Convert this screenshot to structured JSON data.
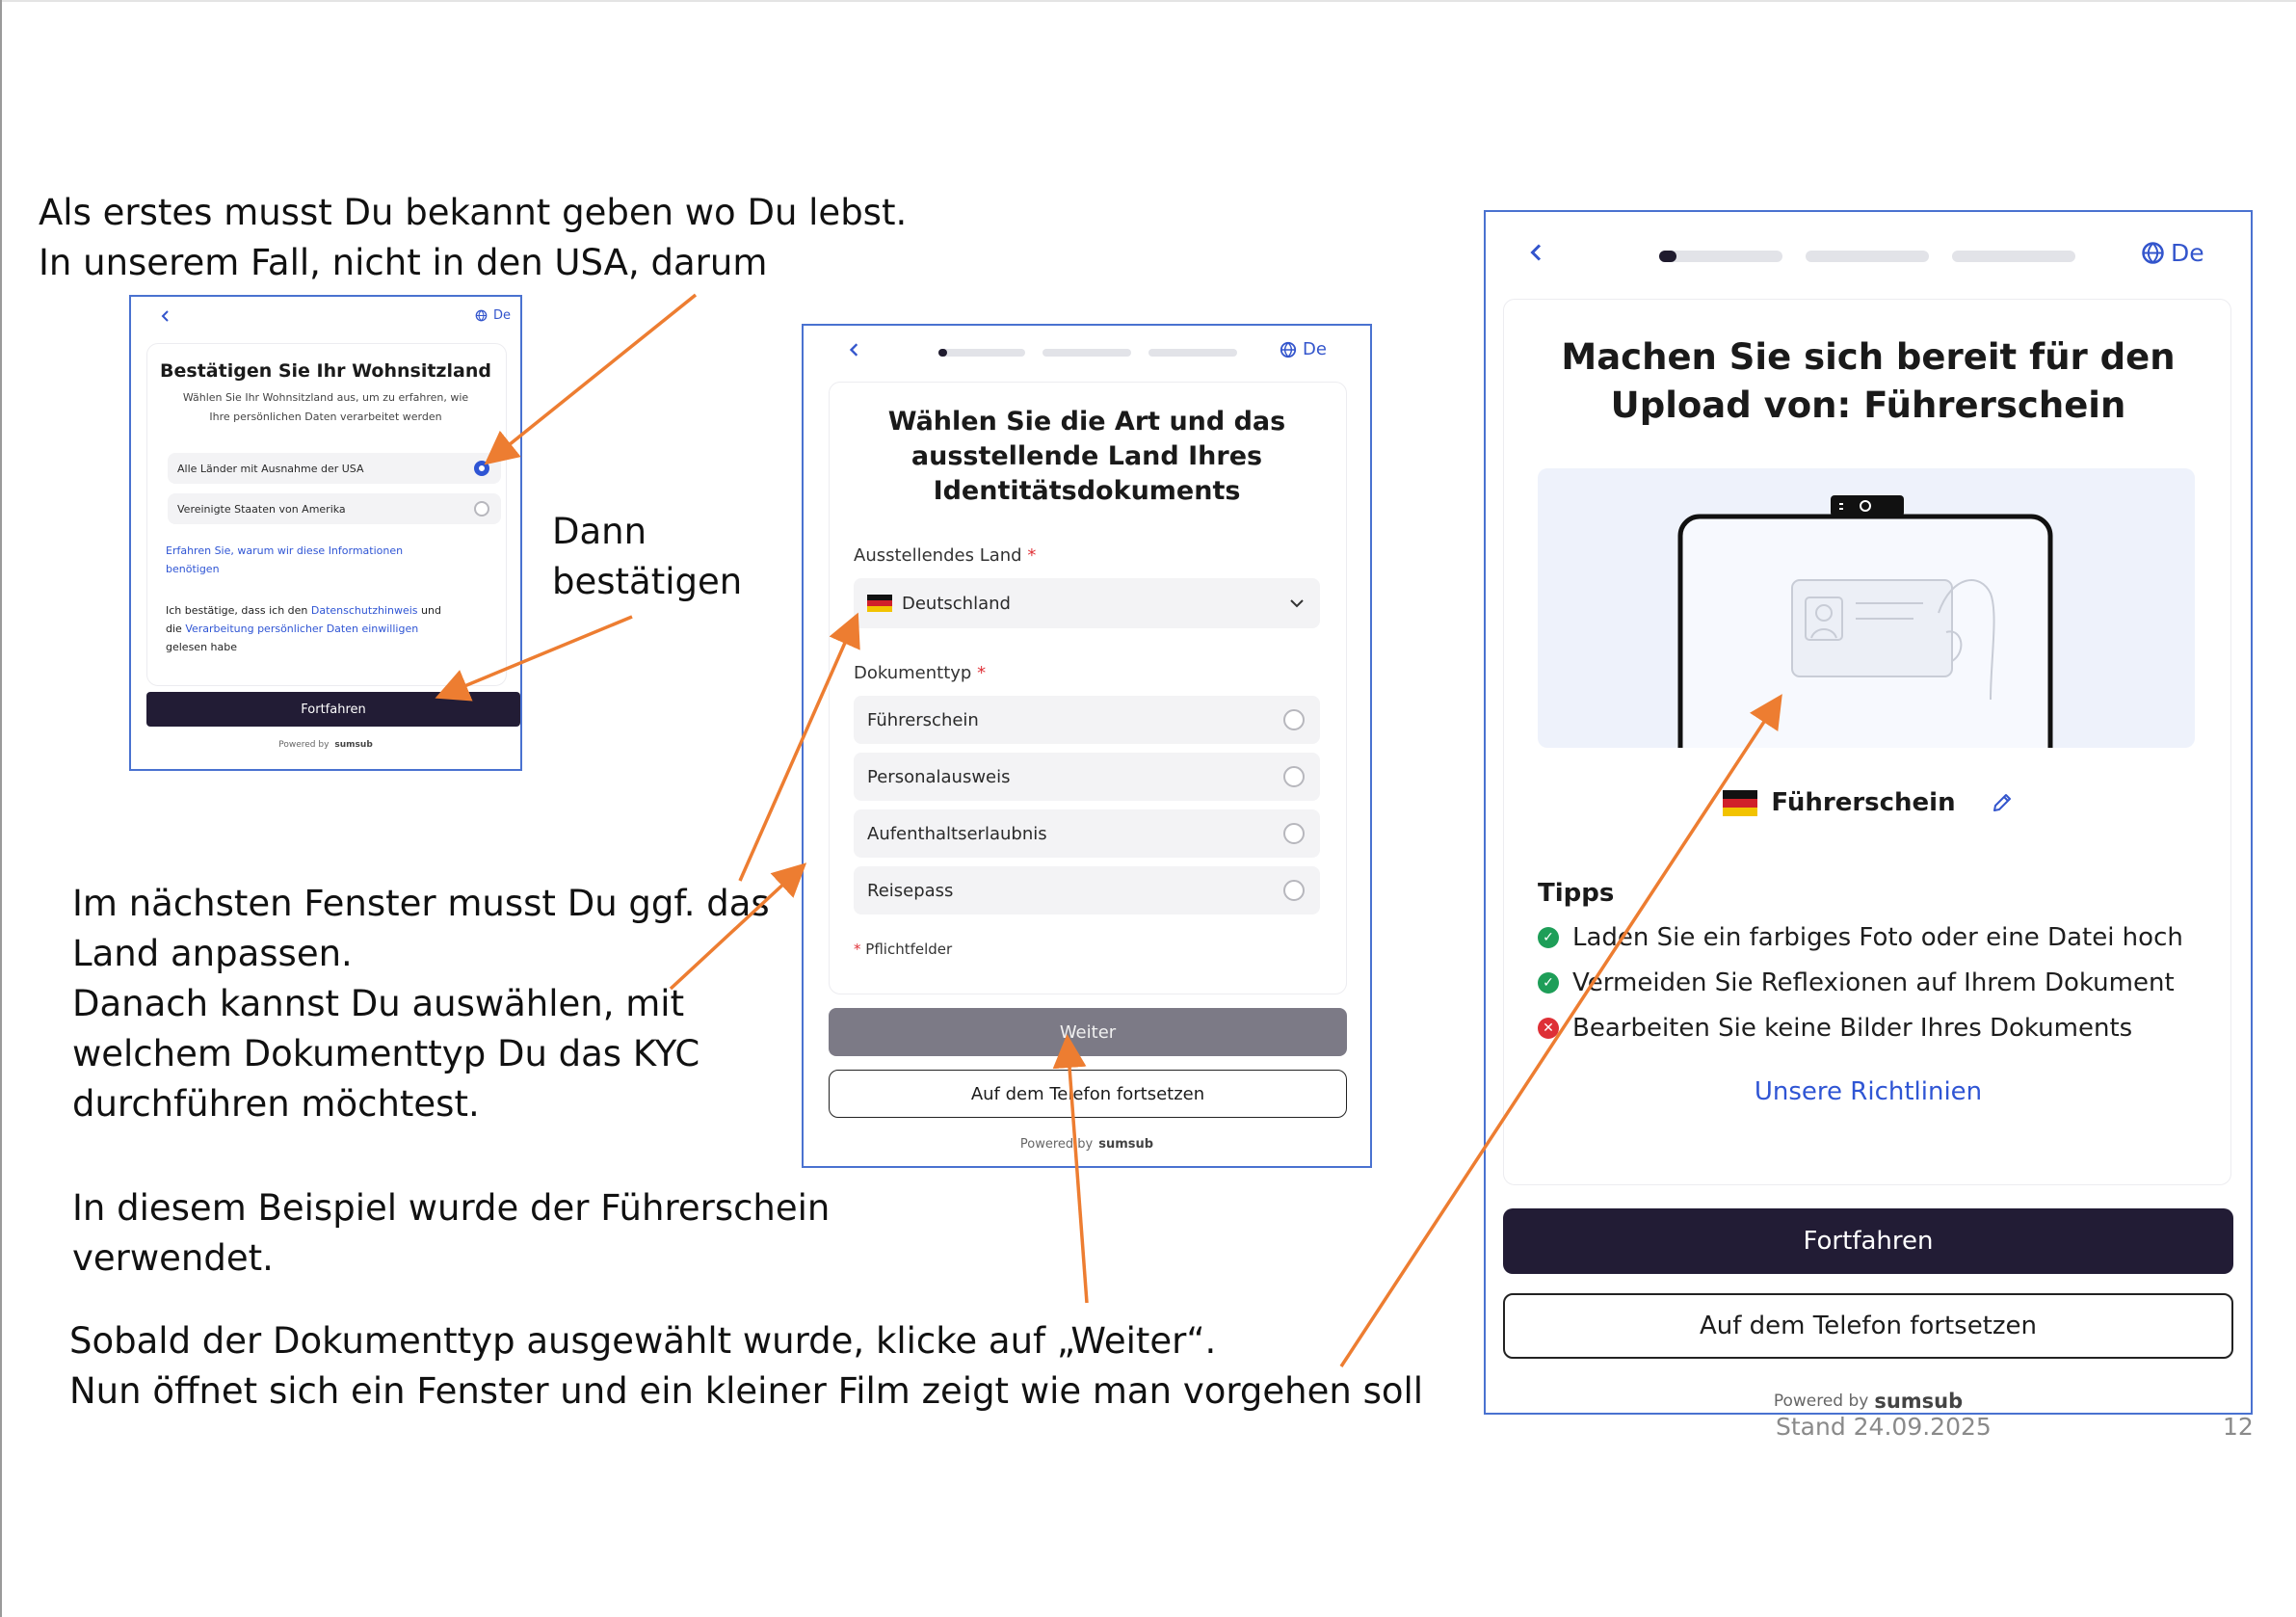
{
  "notes": {
    "intro_line1": "Als erstes musst Du bekannt geben wo Du lebst.",
    "intro_line2": "In unserem Fall, nicht in den USA, darum",
    "confirm_line1": "Dann",
    "confirm_line2": "bestätigen",
    "next_line1": "Im nächsten Fenster musst Du ggf. das",
    "next_line2": "Land anpassen.",
    "next_line3": "Danach kannst Du auswählen, mit",
    "next_line4": "welchem Dokumenttyp Du das KYC",
    "next_line5": "durchführen möchtest.",
    "example_line1": "In diesem Beispiel wurde der Führerschein",
    "example_line2": "verwendet.",
    "final_line1": "Sobald der Dokumenttyp ausgewählt wurde, klicke auf „Weiter“.",
    "final_line2": "Nun öffnet sich ein Fenster und ein kleiner Film zeigt wie man vorgehen soll"
  },
  "footer": {
    "date": "Stand 24.09.2025",
    "page": "12"
  },
  "colors": {
    "accent": "#2f55d4",
    "primary_button": "#221c35",
    "arrow": "#ed7d31",
    "frame": "#4a72d0"
  },
  "screen1": {
    "back_icon": "chevron-left-icon",
    "lang": "De",
    "title": "Bestätigen Sie Ihr Wohnsitzland",
    "subtitle_line1": "Wählen Sie Ihr Wohnsitzland aus, um zu erfahren, wie",
    "subtitle_line2": "Ihre persönlichen Daten verarbeitet werden",
    "options": [
      {
        "label": "Alle Länder mit Ausnahme der USA",
        "selected": true
      },
      {
        "label": "Vereinigte Staaten von Amerika",
        "selected": false
      }
    ],
    "learn_more_line1": "Erfahren Sie, warum wir diese Informationen",
    "learn_more_line2": "benötigen",
    "consent_a": "Ich bestätige, dass ich den ",
    "consent_link1": "Datenschutzhinweis",
    "consent_b": " und",
    "consent_c": "die ",
    "consent_link2": "Verarbeitung persönlicher Daten einwilligen",
    "consent_d": "gelesen habe",
    "continue": "Fortfahren",
    "powered_by": "Powered by",
    "brand": "sumsub"
  },
  "screen2": {
    "lang": "De",
    "progress": [
      0.1,
      0,
      0
    ],
    "title_line1": "Wählen Sie die Art und das",
    "title_line2": "ausstellende Land Ihres",
    "title_line3": "Identitätsdokuments",
    "country_label": "Ausstellendes Land",
    "required_mark": "*",
    "country_value": "Deutschland",
    "doctype_label": "Dokumenttyp",
    "doc_options": [
      "Führerschein",
      "Personalausweis",
      "Aufenthaltserlaubnis",
      "Reisepass"
    ],
    "required_note": "Pflichtfelder",
    "next": "Weiter",
    "phone": "Auf dem Telefon fortsetzen",
    "powered_by": "Powered by",
    "brand": "sumsub"
  },
  "screen3": {
    "lang": "De",
    "progress": [
      0.15,
      0,
      0
    ],
    "title_line1": "Machen Sie sich bereit für den",
    "title_line2": "Upload von: Führerschein",
    "document": "Führerschein",
    "tips_title": "Tipps",
    "tips": [
      {
        "text": "Laden Sie ein farbiges Foto oder eine Datei hoch",
        "ok": true
      },
      {
        "text": "Vermeiden Sie Reflexionen auf Ihrem Dokument",
        "ok": true
      },
      {
        "text": "Bearbeiten Sie keine Bilder Ihres Dokuments",
        "ok": false
      }
    ],
    "guidelines": "Unsere Richtlinien",
    "continue": "Fortfahren",
    "phone": "Auf dem Telefon fortsetzen",
    "powered_by": "Powered by",
    "brand": "sumsub"
  }
}
